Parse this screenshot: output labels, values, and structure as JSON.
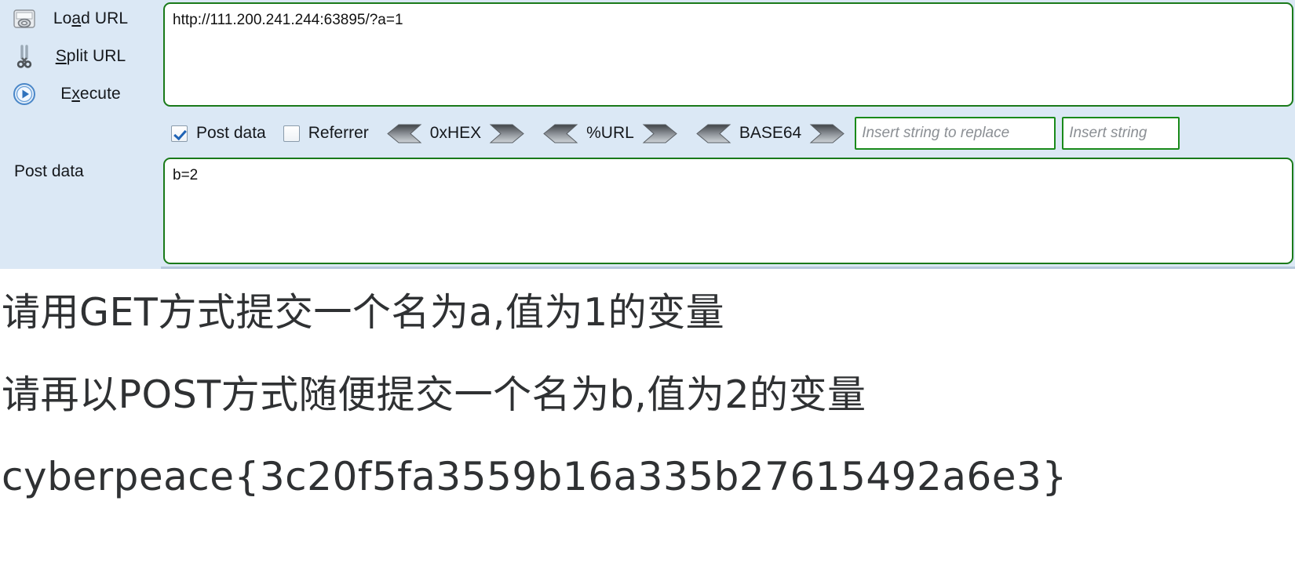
{
  "hackbar": {
    "actions": [
      {
        "label_pre": "Lo",
        "label_key": "a",
        "label_post": "d URL",
        "icon": "load-url-icon"
      },
      {
        "label_pre": "",
        "label_key": "S",
        "label_post": "plit URL",
        "icon": "scissors-icon"
      },
      {
        "label_pre": "E",
        "label_key": "x",
        "label_post": "ecute",
        "icon": "execute-play-icon"
      }
    ],
    "url_field": {
      "value": "http://111.200.241.244:63895/?a=1",
      "placeholder": ""
    },
    "post_data_label": "Post data",
    "post_data_field": {
      "value": "b=2",
      "placeholder": ""
    },
    "toolbar": {
      "checkboxes": [
        {
          "label": "Post data",
          "checked": true
        },
        {
          "label": "Referrer",
          "checked": false
        }
      ],
      "converters": [
        {
          "label": "0xHEX"
        },
        {
          "label": "%URL"
        },
        {
          "label": "BASE64"
        }
      ],
      "replace_inputs": [
        {
          "placeholder": "Insert string to replace",
          "value": ""
        },
        {
          "placeholder": "Insert string",
          "value": ""
        }
      ]
    }
  },
  "content": {
    "lines": [
      "请用GET方式提交一个名为a,值为1的变量",
      "请再以POST方式随便提交一个名为b,值为2的变量",
      "cyberpeace{3c20f5fa3559b16a335b27615492a6e3}"
    ]
  },
  "colors": {
    "panel_bg": "#dbe8f5",
    "field_border": "#1a7a1a",
    "accent_blue": "#1f63b5",
    "text": "#15181c",
    "content_text": "#2f3133"
  }
}
